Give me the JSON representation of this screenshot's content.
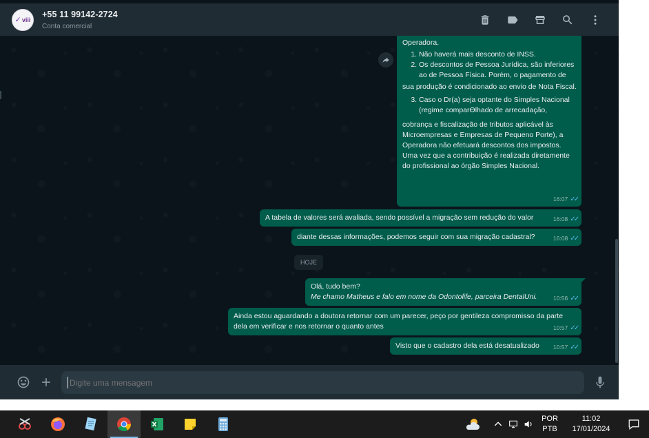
{
  "header": {
    "avatar_text": "viii",
    "contact_name": "+55 11 99142-2724",
    "contact_subtitle": "Conta comercial",
    "actions": [
      "delete-icon",
      "label-icon",
      "store-icon",
      "search-icon",
      "menu-icon"
    ]
  },
  "messages": {
    "big": {
      "line_top": "Operadora.",
      "item1": "Não haverá mais desconto de INSS.",
      "item2": "Os descontos de Pessoa Jurídica, são inferiores ao de Pessoa Física. Porém, o pagamento de",
      "para1": "sua produção é condicionado ao envio de Nota Fiscal.",
      "item3": "Caso o Dr(a) seja optante do Simples Nacional (regime comparϴlhado de arrecadação,",
      "para2": "cobrança e fiscalização de tributos aplicável às Microempresas e Empresas de Pequeno Porte), a Operadora não efetuará descontos dos impostos. Uma vez que a contribuição é realizada diretamente do profissional ao órgão Simples Nacional.",
      "time": "16:07"
    },
    "m2": {
      "text": "A tabela de valores será avaliada, sendo possível a migração sem redução do valor",
      "time": "16:08"
    },
    "m3": {
      "text": "diante dessas informações, podemos seguir com sua migração cadastral?",
      "time": "16:08"
    },
    "date_chip": "HOJE",
    "m4": {
      "line1": "Olá, tudo bem?",
      "line2": "Me chamo Matheus e falo em nome da Odontolife, parceira DentalUni.",
      "time": "10:56"
    },
    "m5": {
      "text": "Ainda estou aguardando a doutora retornar com um parecer, peço por gentileza compromisso da parte dela em verificar e nos retornar o quanto antes",
      "time": "10:57"
    },
    "m6": {
      "text": "Visto que o cadastro dela está desatualizado",
      "time": "10:57"
    }
  },
  "compose": {
    "placeholder": "Digite uma mensagem",
    "icons": [
      "emoji-icon",
      "plus-icon",
      "microphone-icon"
    ]
  },
  "taskbar": {
    "apps": [
      "snipping-tool-icon",
      "firefox-icon",
      "notepad-icon",
      "chrome-icon",
      "excel-icon",
      "sticky-notes-icon",
      "calculator-icon"
    ],
    "lang_line1": "POR",
    "lang_line2": "PTB",
    "time": "11:02",
    "date": "17/01/2024"
  },
  "colors": {
    "outgoing_bubble": "#005c4b",
    "header_bg": "#202c33",
    "chat_bg": "#0b141a",
    "read_ticks": "#53bdeb"
  }
}
